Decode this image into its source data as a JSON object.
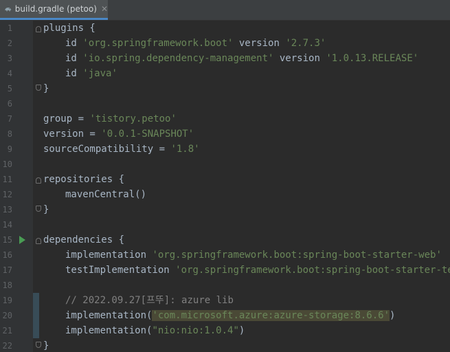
{
  "tab": {
    "title": "build.gradle (petoo)",
    "close": "✕"
  },
  "lines": [
    {
      "n": "1",
      "t1": "plugins {"
    },
    {
      "n": "2",
      "t1": "id ",
      "t2": "'org.springframework.boot'",
      "t3": " version ",
      "t4": "'2.7.3'"
    },
    {
      "n": "3",
      "t1": "id ",
      "t2": "'io.spring.dependency-management'",
      "t3": " version ",
      "t4": "'1.0.13.RELEASE'"
    },
    {
      "n": "4",
      "t1": "id ",
      "t2": "'java'"
    },
    {
      "n": "5",
      "t1": "}"
    },
    {
      "n": "6"
    },
    {
      "n": "7",
      "t1": "group = ",
      "t2": "'tistory.petoo'"
    },
    {
      "n": "8",
      "t1": "version = ",
      "t2": "'0.0.1-SNAPSHOT'"
    },
    {
      "n": "9",
      "t1": "sourceCompatibility = ",
      "t2": "'1.8'"
    },
    {
      "n": "10"
    },
    {
      "n": "11",
      "t1": "repositories {"
    },
    {
      "n": "12",
      "t1": "mavenCentral()"
    },
    {
      "n": "13",
      "t1": "}"
    },
    {
      "n": "14"
    },
    {
      "n": "15",
      "t1": "dependencies {"
    },
    {
      "n": "16",
      "t1": "implementation ",
      "t2": "'org.springframework.boot:spring-boot-starter-web'"
    },
    {
      "n": "17",
      "t1": "testImplementation ",
      "t2": "'org.springframework.boot:spring-boot-starter-test'"
    },
    {
      "n": "18"
    },
    {
      "n": "19",
      "t1": "// 2022.09.27[프뚜]: azure lib"
    },
    {
      "n": "20",
      "t1": "implementation(",
      "t2": "'com.microsoft.azure:azure-storage:8.6.6'",
      "t3": ")"
    },
    {
      "n": "21",
      "t1": "implementation(",
      "t2": "\"nio:nio:1.0.4\"",
      "t3": ")"
    },
    {
      "n": "22",
      "t1": "}"
    }
  ]
}
